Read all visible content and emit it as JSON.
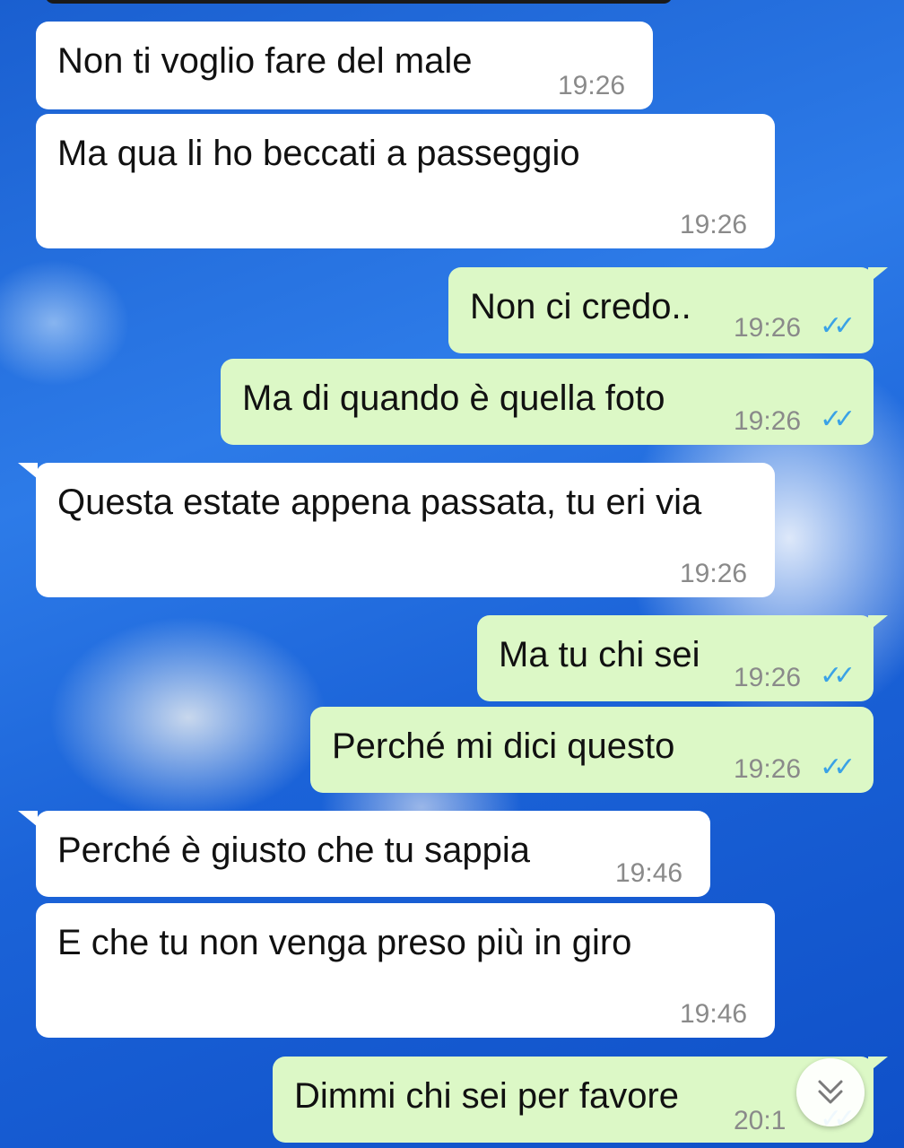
{
  "messages": [
    {
      "text": "Non ti voglio fare del male",
      "time": "19:26",
      "direction": "incoming"
    },
    {
      "text": "Ma qua li ho beccati a passeggio",
      "time": "19:26",
      "direction": "incoming"
    },
    {
      "text": "Non ci credo..",
      "time": "19:26",
      "direction": "outgoing",
      "status": "read"
    },
    {
      "text": "Ma di quando è quella foto",
      "time": "19:26",
      "direction": "outgoing",
      "status": "read"
    },
    {
      "text": "Questa estate appena passata, tu eri via",
      "time": "19:26",
      "direction": "incoming"
    },
    {
      "text": "Ma tu chi sei",
      "time": "19:26",
      "direction": "outgoing",
      "status": "read"
    },
    {
      "text": "Perché mi dici questo",
      "time": "19:26",
      "direction": "outgoing",
      "status": "read"
    },
    {
      "text": "Perché è giusto che tu sappia",
      "time": "19:46",
      "direction": "incoming"
    },
    {
      "text": "E che tu non venga preso più in giro",
      "time": "19:46",
      "direction": "incoming"
    },
    {
      "text": "Dimmi chi sei per favore",
      "time": "20:1",
      "direction": "outgoing",
      "status": "read"
    }
  ],
  "icons": {
    "read_receipt": "double-check-icon",
    "scroll_down": "chevron-double-down-icon"
  },
  "colors": {
    "incoming_bubble": "#ffffff",
    "outgoing_bubble": "#dcf8c6",
    "read_ticks": "#3aa2e6",
    "background": "#1b63d8"
  }
}
